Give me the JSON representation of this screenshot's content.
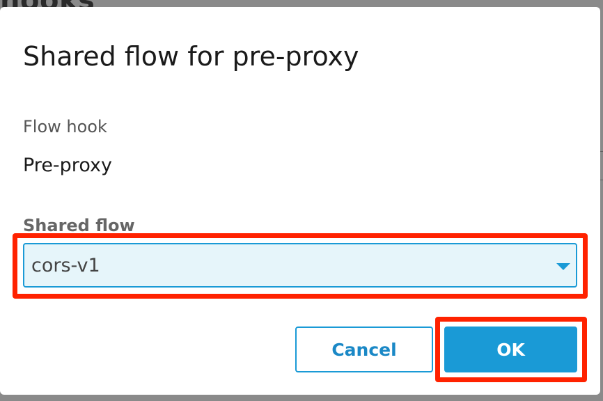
{
  "backdrop": {
    "heading_fragment": "hooks"
  },
  "dialog": {
    "title": "Shared flow for pre-proxy",
    "flow_hook": {
      "label": "Flow hook",
      "value": "Pre-proxy"
    },
    "shared_flow": {
      "label": "Shared flow",
      "selected": "cors-v1"
    },
    "buttons": {
      "cancel": "Cancel",
      "ok": "OK"
    }
  },
  "colors": {
    "accent": "#1a9ad6",
    "select_background": "#e6f5fa",
    "annotation_highlight": "#ff2200"
  }
}
